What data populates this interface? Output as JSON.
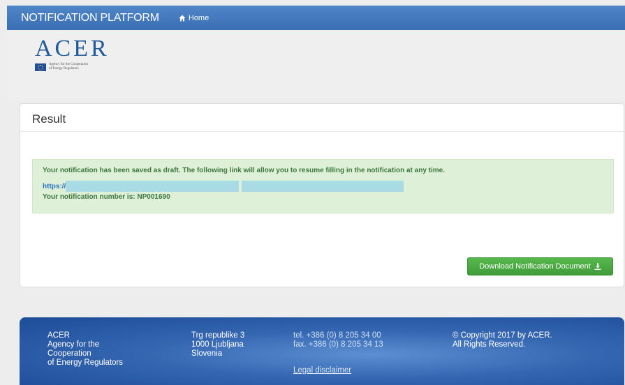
{
  "navbar": {
    "brand": "NOTIFICATION PLATFORM",
    "home_label": "Home"
  },
  "logo": {
    "word": "ACER",
    "tagline_1": "Agency for the Cooperation",
    "tagline_2": "of Energy Regulators"
  },
  "result": {
    "title": "Result",
    "message": "Your notification has been saved as draft. The following link will allow you to resume filling in the notification at any time.",
    "link_prefix": "https://",
    "number_text": "Your notification number is: NP001690",
    "download_label": "Download Notification Document"
  },
  "footer": {
    "col1": [
      "ACER",
      "Agency for the",
      "Cooperation",
      "of Energy Regulators"
    ],
    "col2": [
      "Trg republike 3",
      "1000 Ljubljana",
      "Slovenia"
    ],
    "col3": [
      "tel. +386 (0) 8 205 34 00",
      "fax. +386 (0) 8 205 34 13"
    ],
    "legal": "Legal disclaimer",
    "col4": [
      "© Copyright 2017 by ACER.",
      "All Rights Reserved."
    ]
  },
  "colors": {
    "navbar": "#3a6fb3",
    "alert_bg": "#dff0d8",
    "alert_text": "#3c763d",
    "button": "#47a640",
    "footer": "#3566b0"
  }
}
